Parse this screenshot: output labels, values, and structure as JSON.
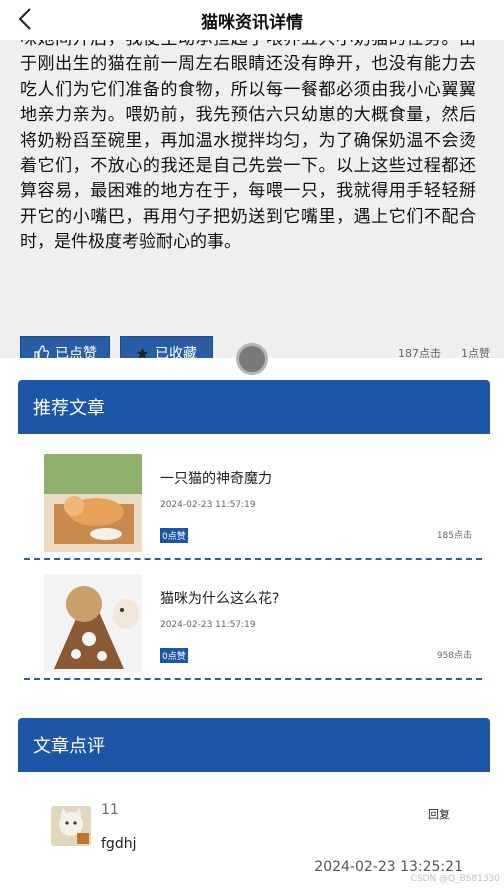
{
  "header": {
    "title": "猫咪资讯详情",
    "back_icon": "chevron-left-icon"
  },
  "article": {
    "body": "咪她间开后，我便主动承担起了喂养五只小奶猫的任务。由于刚出生的猫在前一周左右眼睛还没有睁开，也没有能力去吃人们为它们准备的食物，所以每一餐都必须由我小心翼翼地亲力亲为。喂奶前，我先预估六只幼崽的大概食量，然后将奶粉舀至碗里，再加温水搅拌均匀，为了确保奶温不会烫着它们，不放心的我还是自己先尝一下。以上这些过程都还算容易，最困难的地方在于，每喂一只，我就得用手轻轻掰开它的小嘴巴，再用勺子把奶送到它嘴里，遇上它们不配合时，是件极度考验耐心的事。",
    "like_label": "已点赞",
    "fav_label": "已收藏",
    "views": "187点击",
    "likes": "1点赞"
  },
  "recommend": {
    "title": "推荐文章",
    "items": [
      {
        "title": "一只猫的神奇魔力",
        "date": "2024-02-23 11:57:19",
        "likes": "0点赞",
        "views": "185点击"
      },
      {
        "title": "猫咪为什么这么花?",
        "date": "2024-02-23 11:57:19",
        "likes": "0点赞",
        "views": "958点击"
      }
    ]
  },
  "comments": {
    "title": "文章点评",
    "items": [
      {
        "user": "11",
        "text": "fgdhj",
        "reply": "回复",
        "time": "2024-02-23 13:25:21"
      }
    ]
  },
  "watermark": "CSDN @Q_BS81330",
  "colors": {
    "primary": "#1d56a6",
    "background": "#efefef"
  }
}
